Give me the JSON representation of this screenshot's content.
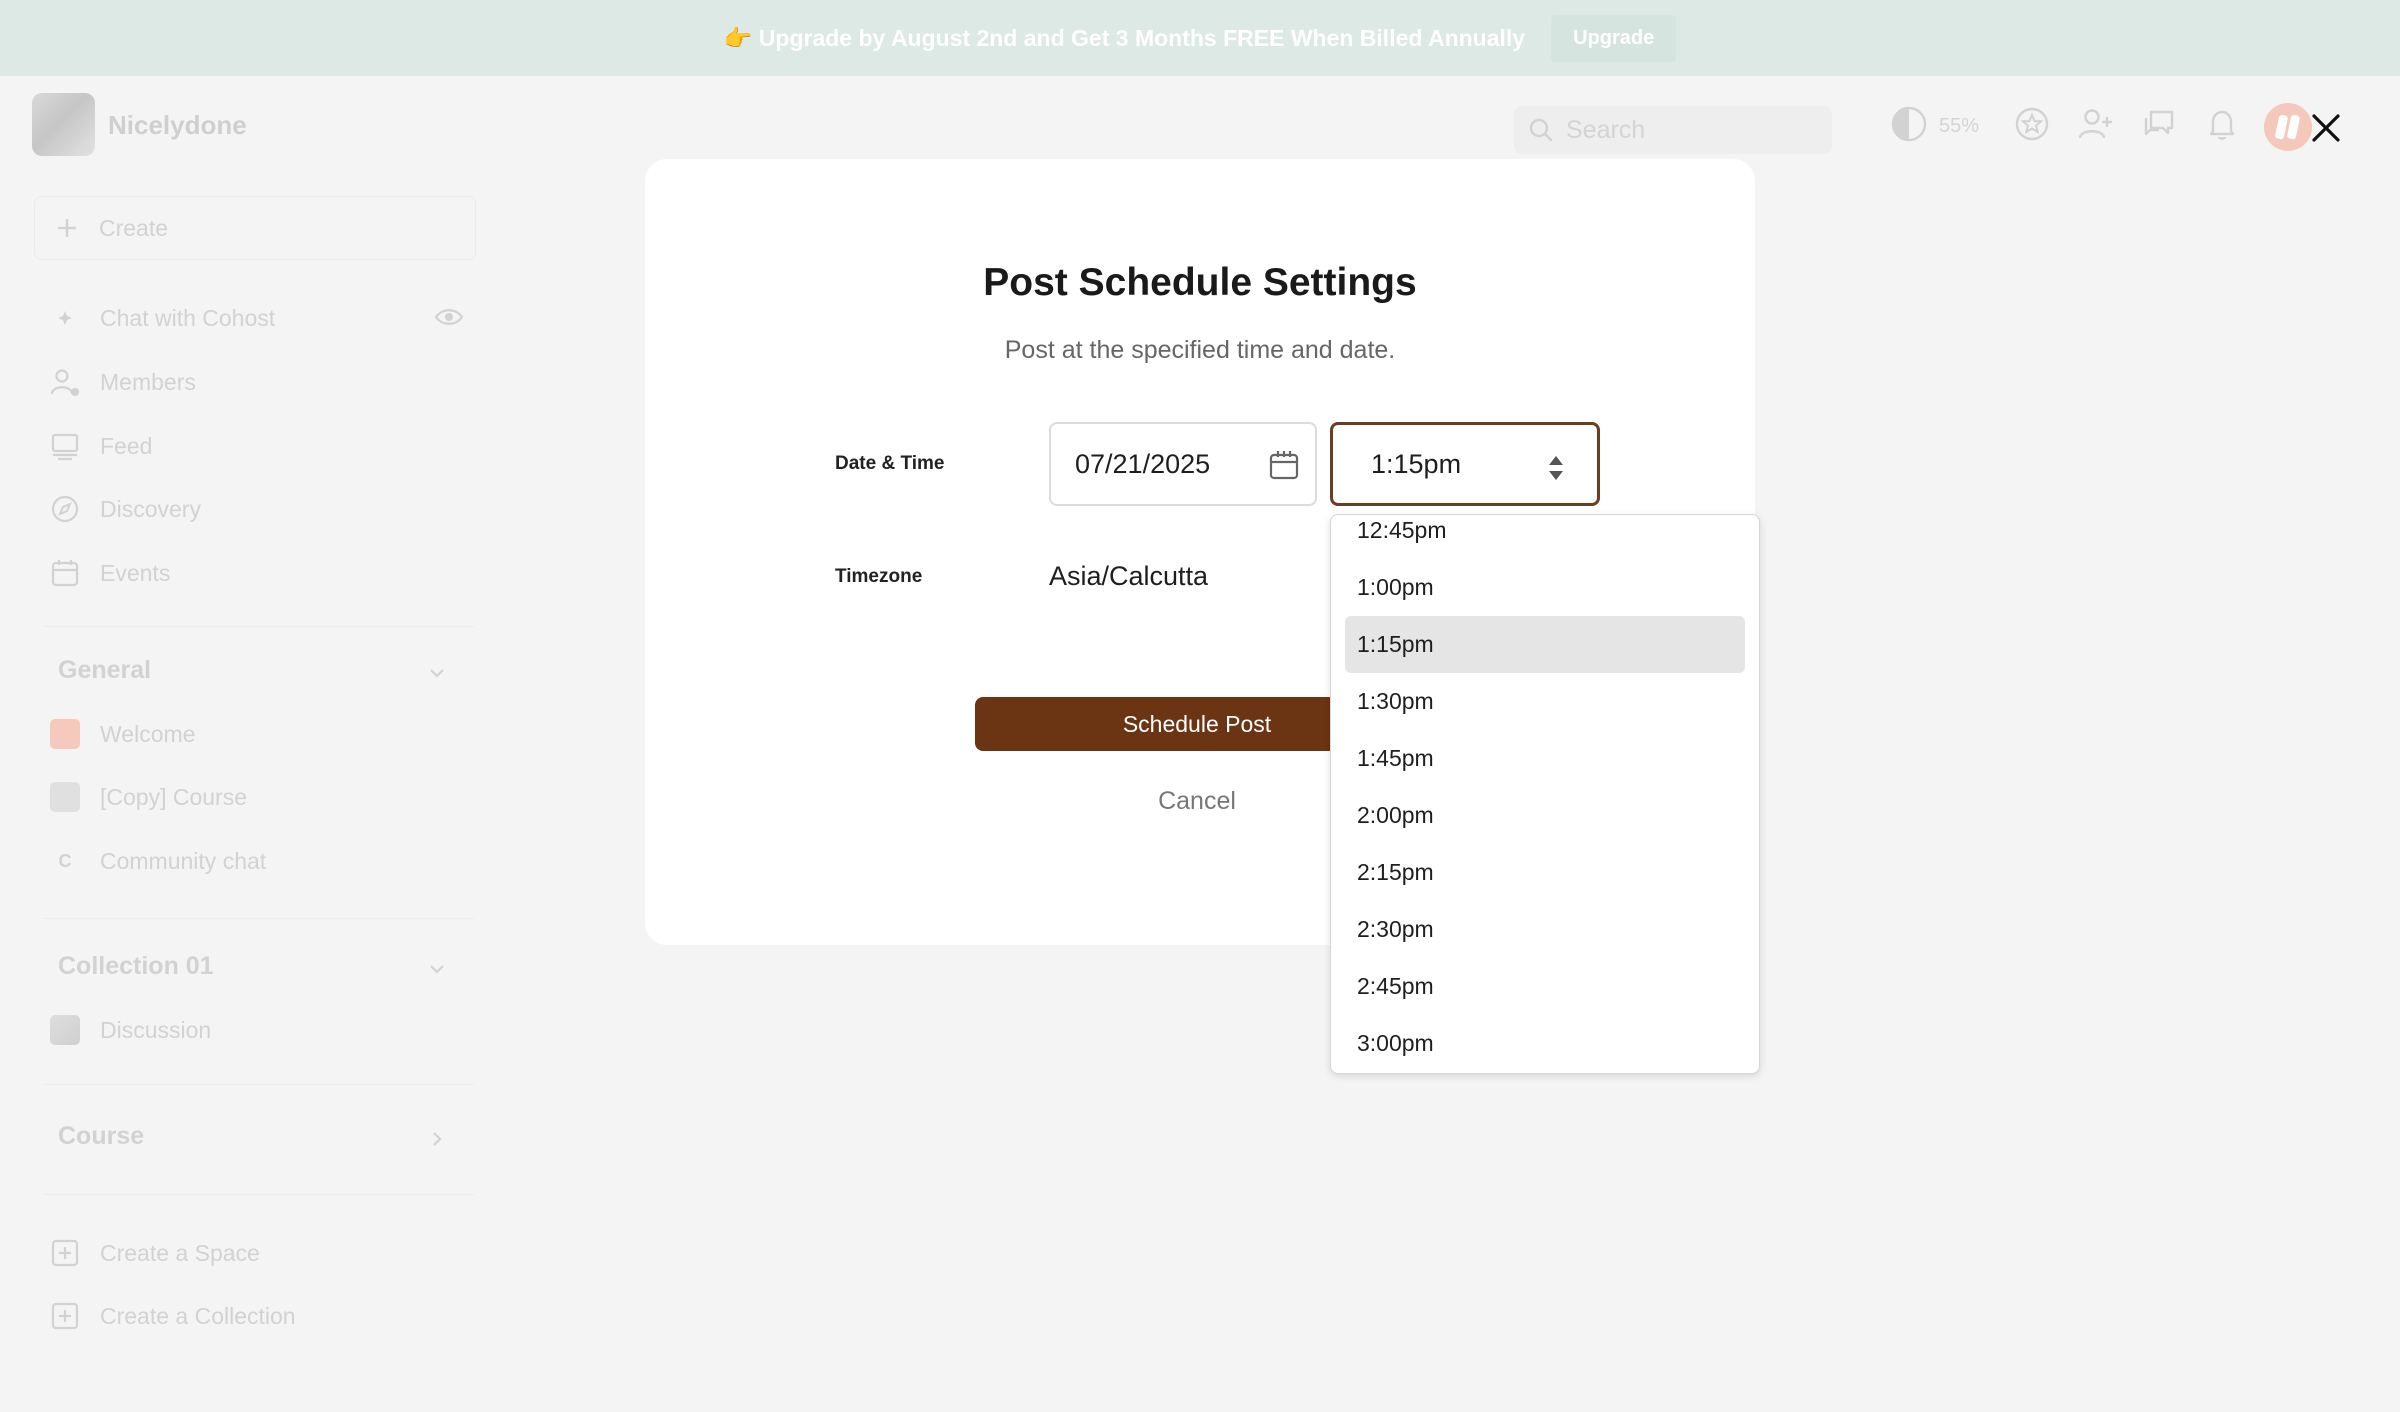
{
  "banner": {
    "text": "👉 Upgrade by August 2nd and Get 3 Months FREE When Billed Annually",
    "button": "Upgrade"
  },
  "header": {
    "brand": "Nicelydone",
    "search_placeholder": "Search",
    "contrast_percent": "55%",
    "icons": [
      "contrast-icon",
      "star-badge-icon",
      "add-user-icon",
      "chat-icon",
      "bell-icon"
    ]
  },
  "sidebar": {
    "create": "Create",
    "items": [
      {
        "label": "Chat with Cohost",
        "icon": "sparkle-icon"
      },
      {
        "label": "Members",
        "icon": "members-icon"
      },
      {
        "label": "Feed",
        "icon": "feed-icon"
      },
      {
        "label": "Discovery",
        "icon": "compass-icon"
      },
      {
        "label": "Events",
        "icon": "calendar-icon"
      }
    ],
    "sections": [
      {
        "title": "General",
        "items": [
          "Welcome",
          "[Copy] Course",
          "Community chat"
        ]
      },
      {
        "title": "Collection 01",
        "items": [
          "Discussion"
        ]
      },
      {
        "title": "Course",
        "items": []
      }
    ],
    "community_chat_initial": "C",
    "footer": [
      "Create a Space",
      "Create a Collection"
    ]
  },
  "modal": {
    "title": "Post Schedule Settings",
    "subtitle": "Post at the specified time and date.",
    "date_time_label": "Date & Time",
    "date_value": "07/21/2025",
    "time_value": "1:15pm",
    "timezone_label": "Timezone",
    "timezone_value": "Asia/Calcutta",
    "schedule_button": "Schedule Post",
    "cancel_button": "Cancel"
  },
  "dropdown": {
    "options": [
      "12:45pm",
      "1:00pm",
      "1:15pm",
      "1:30pm",
      "1:45pm",
      "2:00pm",
      "2:15pm",
      "2:30pm",
      "2:45pm",
      "3:00pm"
    ],
    "selected": "1:15pm"
  },
  "colors": {
    "accent_brown": "#6b3413",
    "focus_border": "#6b3d22",
    "banner_bg": "#dde9e5",
    "overlay_text": "#d2d2d2"
  }
}
